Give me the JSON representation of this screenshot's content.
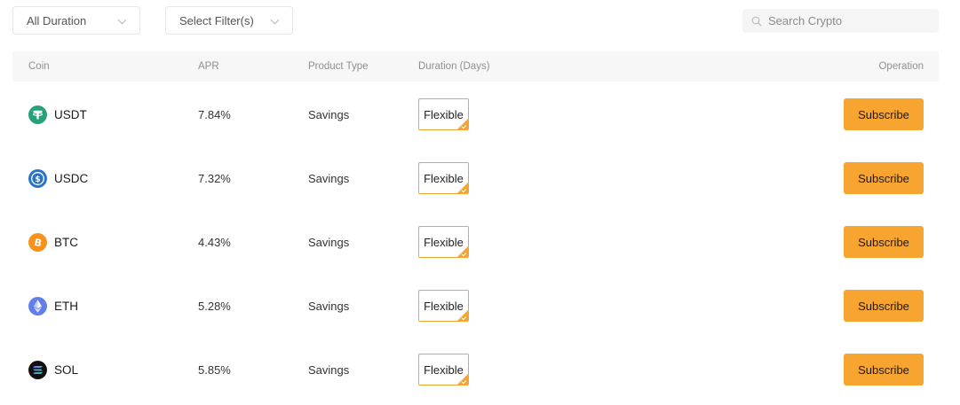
{
  "filters": {
    "duration_label": "All Duration",
    "filter_label": "Select Filter(s)"
  },
  "search": {
    "placeholder": "Search Crypto"
  },
  "table": {
    "headers": {
      "coin": "Coin",
      "apr": "APR",
      "product_type": "Product Type",
      "duration": "Duration (Days)",
      "operation": "Operation"
    },
    "rows": [
      {
        "coin": "USDT",
        "icon": "usdt-icon",
        "apr": "7.84%",
        "product_type": "Savings",
        "duration": "Flexible",
        "action": "Subscribe"
      },
      {
        "coin": "USDC",
        "icon": "usdc-icon",
        "apr": "7.32%",
        "product_type": "Savings",
        "duration": "Flexible",
        "action": "Subscribe"
      },
      {
        "coin": "BTC",
        "icon": "btc-icon",
        "apr": "4.43%",
        "product_type": "Savings",
        "duration": "Flexible",
        "action": "Subscribe"
      },
      {
        "coin": "ETH",
        "icon": "eth-icon",
        "apr": "5.28%",
        "product_type": "Savings",
        "duration": "Flexible",
        "action": "Subscribe"
      },
      {
        "coin": "SOL",
        "icon": "sol-icon",
        "apr": "5.85%",
        "product_type": "Savings",
        "duration": "Flexible",
        "action": "Subscribe"
      }
    ]
  },
  "colors": {
    "accent": "#f8a430",
    "badge_border": "#f3a534",
    "header_bg": "#f7f7f7",
    "usdt": "#26a17b",
    "usdc": "#2775ca",
    "btc": "#f7931a",
    "eth": "#627eea",
    "sol": "#111111"
  }
}
